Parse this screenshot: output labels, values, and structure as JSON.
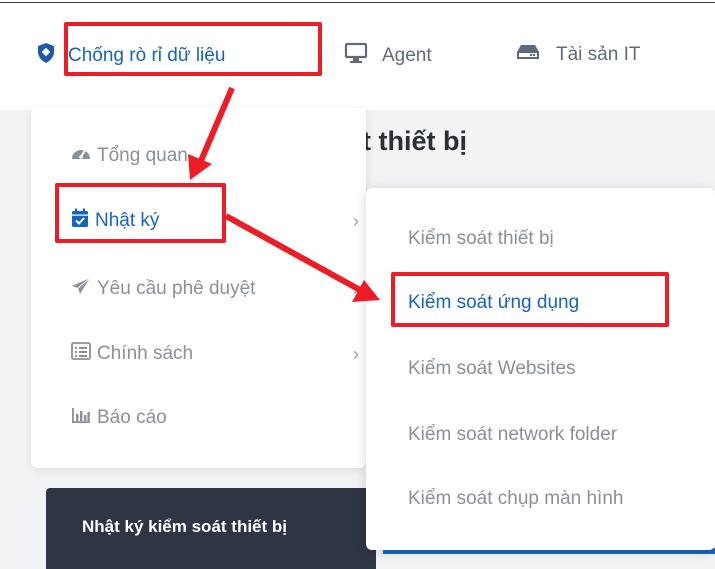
{
  "topnav": {
    "items": [
      {
        "label": "Chống rò rỉ dữ liệu",
        "icon": "shield-icon"
      },
      {
        "label": "Agent",
        "icon": "monitor-icon"
      },
      {
        "label": "Tài sản IT",
        "icon": "hard-drive-icon"
      }
    ]
  },
  "page": {
    "title": "t thiết bị",
    "panel_text": "Nhật ký kiểm soát thiết bị"
  },
  "menu_level1": {
    "items": [
      {
        "label": "Tổng quan",
        "icon": "dashboard-icon"
      },
      {
        "label": "Nhật ký",
        "icon": "calendar-check-icon"
      },
      {
        "label": "Yêu cầu phê duyệt",
        "icon": "paper-plane-icon"
      },
      {
        "label": "Chính sách",
        "icon": "list-icon"
      },
      {
        "label": "Báo cáo",
        "icon": "bar-chart-icon"
      }
    ],
    "submenu_chevron": "›"
  },
  "menu_level2": {
    "items": [
      {
        "label": "Kiểm soát thiết bị"
      },
      {
        "label": "Kiểm soát ứng dụng"
      },
      {
        "label": "Kiểm soát Websites"
      },
      {
        "label": "Kiểm soát network folder"
      },
      {
        "label": "Kiểm soát chụp màn hình"
      }
    ]
  },
  "colors": {
    "accent": "#1565c0",
    "highlight": "#ee1c24",
    "muted_text": "#8a9099",
    "panel_bg": "#2e3545"
  }
}
